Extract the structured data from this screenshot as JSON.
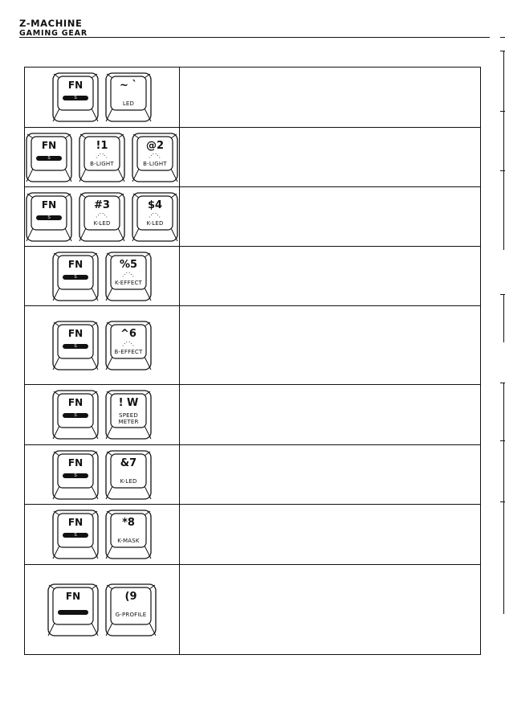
{
  "header": {
    "brand_line1": "Z-MACHINE",
    "brand_line2": "GAMING GEAR"
  },
  "table": {
    "rows": [
      {
        "keys": [
          {
            "main": "FN",
            "sub": "S",
            "type": "fn"
          },
          {
            "main": "~ `",
            "sub": "LED",
            "type": "plain"
          }
        ],
        "description": ""
      },
      {
        "keys": [
          {
            "main": "FN",
            "sub": "S",
            "type": "fn"
          },
          {
            "main": "!1",
            "sub": "B-LIGHT",
            "type": "dots"
          },
          {
            "main": "@2",
            "sub": "B-LIGHT",
            "type": "dots"
          }
        ],
        "description": ""
      },
      {
        "keys": [
          {
            "main": "FN",
            "sub": "S",
            "type": "fn"
          },
          {
            "main": "#3",
            "sub": "K-LED",
            "type": "dots"
          },
          {
            "main": "$4",
            "sub": "K-LED",
            "type": "dots"
          }
        ],
        "description": ""
      },
      {
        "keys": [
          {
            "main": "FN",
            "sub": "S",
            "type": "fn"
          },
          {
            "main": "%5",
            "sub": "K-EFFECT",
            "type": "dots"
          }
        ],
        "description": ""
      },
      {
        "keys": [
          {
            "main": "FN",
            "sub": "S",
            "type": "fn"
          },
          {
            "main": "^6",
            "sub": "B-EFFECT",
            "type": "dots"
          }
        ],
        "description": ""
      },
      {
        "keys": [
          {
            "main": "FN",
            "sub": "S",
            "type": "fn"
          },
          {
            "main": "! W",
            "sub": "SPEED METER",
            "type": "plain"
          }
        ],
        "description": ""
      },
      {
        "keys": [
          {
            "main": "FN",
            "sub": "S",
            "type": "fn"
          },
          {
            "main": "&7",
            "sub": "K-LED",
            "type": "plain"
          }
        ],
        "description": ""
      },
      {
        "keys": [
          {
            "main": "FN",
            "sub": "S",
            "type": "fn"
          },
          {
            "main": "*8",
            "sub": "K-MASK",
            "type": "plain"
          }
        ],
        "description": ""
      },
      {
        "keys": [
          {
            "main": "FN",
            "sub": "",
            "type": "fn"
          },
          {
            "main": "(9",
            "sub": "G-PROFILE",
            "type": "plain"
          }
        ],
        "description": ""
      }
    ]
  }
}
